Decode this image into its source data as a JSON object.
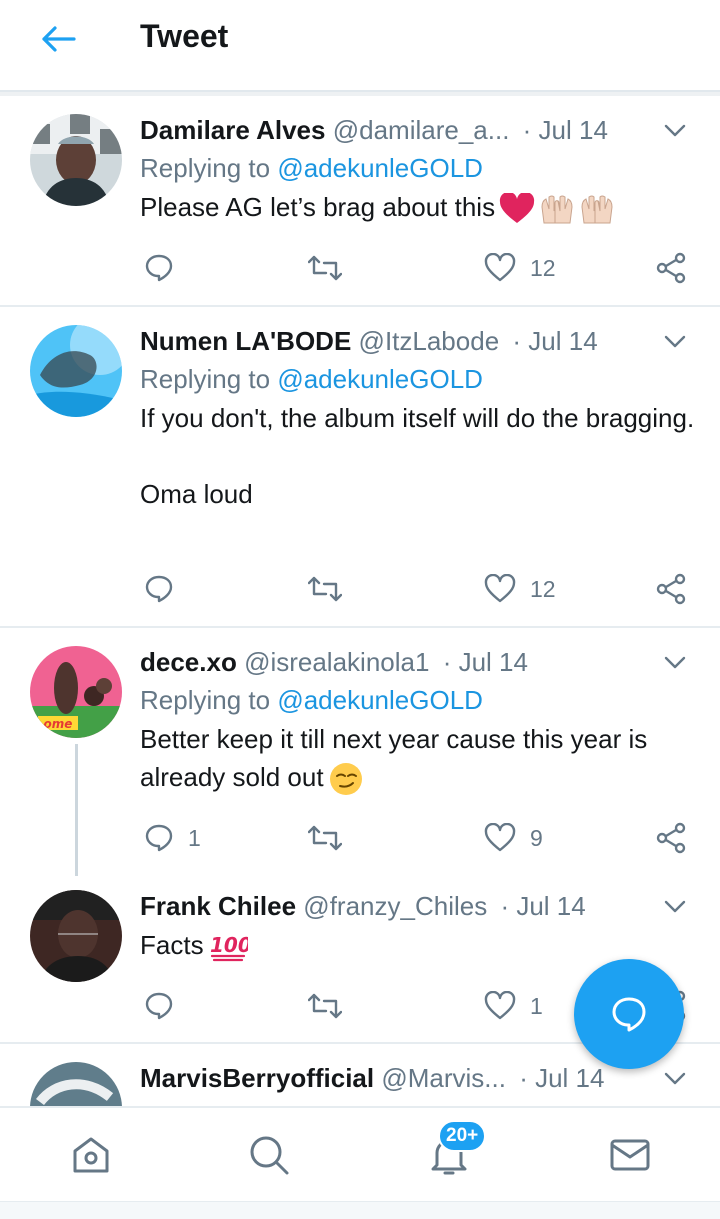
{
  "header": {
    "title": "Tweet"
  },
  "tweets": [
    {
      "name": "Damilare Alves",
      "handle": "@damilare_a...",
      "time": "· Jul 14",
      "replying_prefix": "Replying to ",
      "replying_to": "@adekunleGOLD",
      "text": "Please AG let’s brag about this",
      "emojis": [
        "red-heart",
        "raised-hands",
        "raised-hands"
      ],
      "replies": "",
      "retweets": "",
      "likes": "12"
    },
    {
      "name": "Numen LA'BODE",
      "handle": "@ItzLabode",
      "time": "· Jul 14",
      "replying_prefix": "Replying to ",
      "replying_to": "@adekunleGOLD",
      "text": "If you don't, the album itself will do the bragging.\n\nOma loud",
      "replies": "",
      "retweets": "",
      "likes": "12"
    },
    {
      "name": "dece.xo",
      "handle": "@isrealakinola1",
      "time": "· Jul 14",
      "replying_prefix": "Replying to ",
      "replying_to": "@adekunleGOLD",
      "text": "Better keep it till next year cause this year is already sold out",
      "emojis": [
        "smirking-face"
      ],
      "avatar_text": "ome",
      "replies": "1",
      "retweets": "",
      "likes": "9"
    },
    {
      "name": "Frank Chilee",
      "handle": "@franzy_Chiles",
      "time": "· Jul 14",
      "text": "Facts",
      "emojis": [
        "hundred-points"
      ],
      "emoji_text": "100",
      "replies": "",
      "retweets": "",
      "likes": "1"
    },
    {
      "name": "MarvisBerryofficial",
      "handle": "@Marvis...",
      "time": "· Jul 14"
    }
  ],
  "tabbar": {
    "notifications_badge": "20+"
  },
  "colors": {
    "accent": "#1da1f2",
    "link": "#1b95e0",
    "secondary_text": "#657786",
    "heart": "#e0245e"
  }
}
